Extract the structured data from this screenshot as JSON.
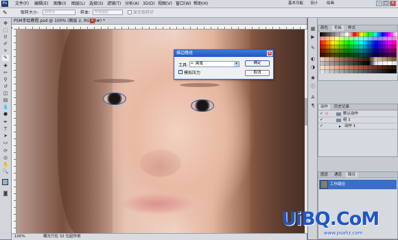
{
  "app": {
    "logo": "Ps",
    "menu": [
      "文件(F)",
      "编辑(E)",
      "图像(I)",
      "图层(L)",
      "选择(S)",
      "滤镜(T)",
      "分析(A)",
      "3D(D)",
      "视图(V)",
      "窗口(W)",
      "帮助(H)"
    ],
    "workspace": [
      "基本功能",
      "设计",
      "绘画"
    ],
    "window_buttons": [
      "–",
      "□",
      "×"
    ]
  },
  "options_bar": {
    "sample_size_label": "取样大小:",
    "sample_size_value": "取样点",
    "sample_label": "样本:",
    "sample_value": "所有图层",
    "show_ring_label": "显示取样环"
  },
  "document": {
    "tab_title": "PSM手绘教程.psd @ 100% (图层 2, RGB/8#) *",
    "zoom": "100%",
    "status_text": "曝光只在 32 位起作用"
  },
  "panels": {
    "swatches_tabs": [
      "颜色",
      "色板",
      "样式"
    ],
    "actions_tabs": [
      "动作",
      "历史记录"
    ],
    "actions_rows": [
      {
        "label": "默认动作",
        "indent": 0
      },
      {
        "label": "组 1",
        "indent": 1
      },
      {
        "label": "动作 1",
        "indent": 2
      }
    ],
    "paths_tabs": [
      "图层",
      "通道",
      "路径"
    ],
    "path_item": "工作路径"
  },
  "dialog": {
    "title": "描边路径",
    "tool_label": "工具:",
    "tool_value": "画笔",
    "ok_label": "确定",
    "cancel_label": "取消",
    "simulate_pressure_label": "模拟压力",
    "simulate_pressure_checked": true
  },
  "watermark": {
    "text": "UiBQ.CoM",
    "url": "www.psahz.com"
  },
  "colors": {
    "dialog_title": "#2458b8",
    "selection_blue": "#3a6fc7",
    "watermark": "#1f56c9"
  }
}
